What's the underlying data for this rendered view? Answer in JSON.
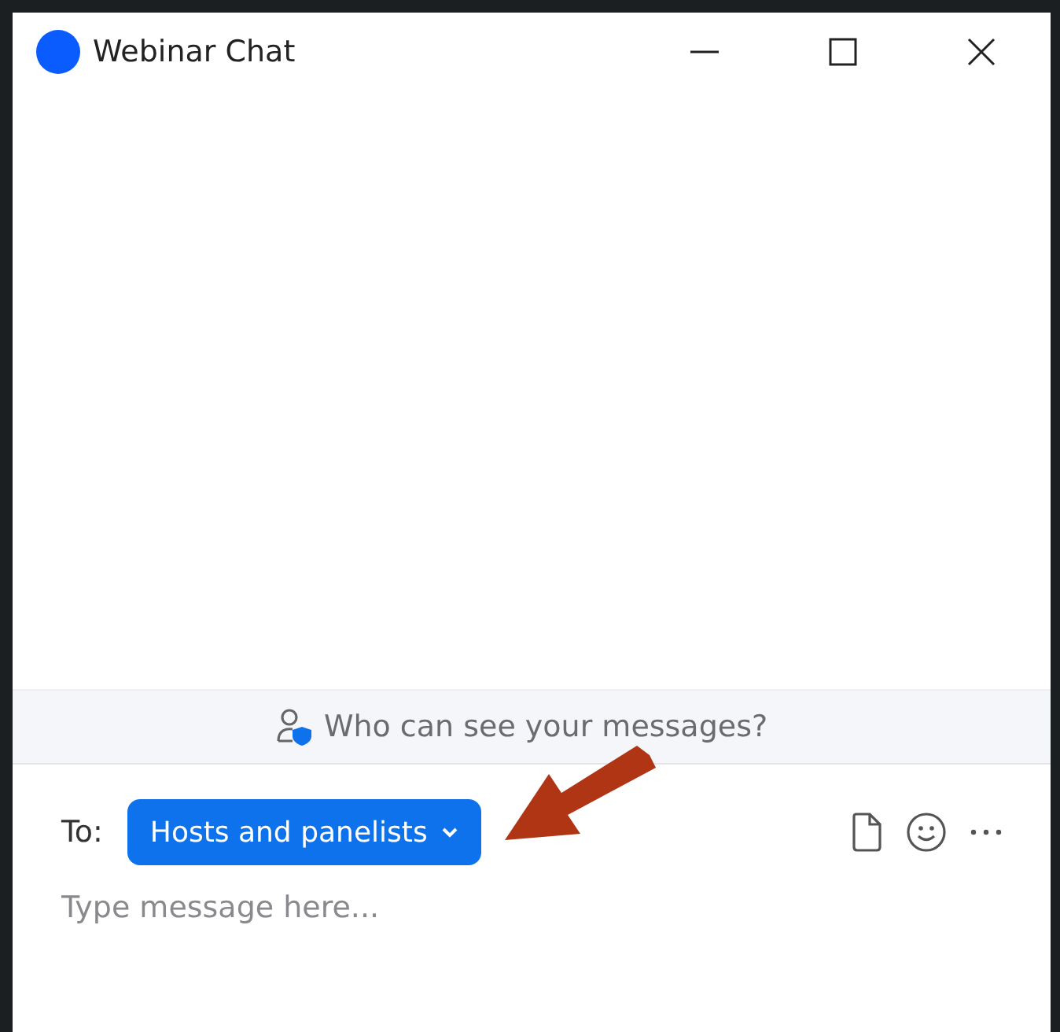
{
  "window": {
    "title": "Webinar Chat"
  },
  "privacy_notice": {
    "text": "Who can see your messages?"
  },
  "recipient": {
    "label": "To:",
    "value": "Hosts and panelists"
  },
  "message_input": {
    "placeholder": "Type message here..."
  }
}
